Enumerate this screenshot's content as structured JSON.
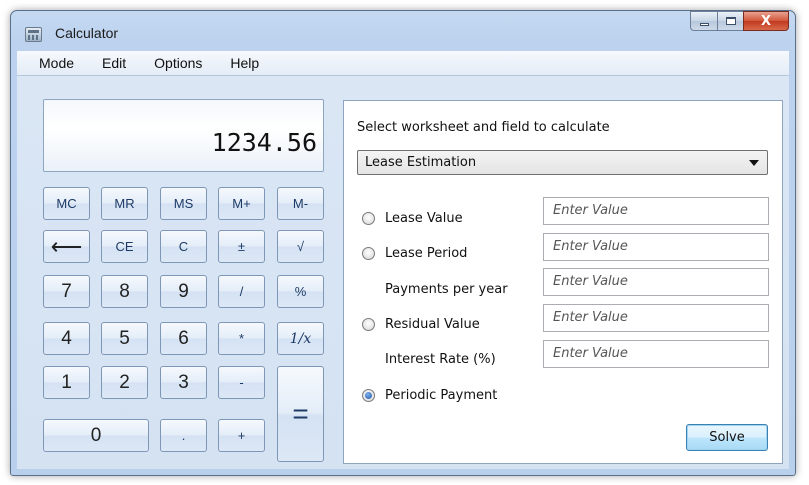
{
  "window": {
    "title": "Calculator",
    "close_glyph": "X"
  },
  "menu": [
    "Mode",
    "Edit",
    "Options",
    "Help"
  ],
  "display": {
    "value": "1234.56"
  },
  "keys": {
    "mc": "MC",
    "mr": "MR",
    "ms": "MS",
    "mplus": "M+",
    "mminus": "M-",
    "backspace": "⟵",
    "ce": "CE",
    "c": "C",
    "plusminus": "±",
    "sqrt": "√",
    "k7": "7",
    "k8": "8",
    "k9": "9",
    "div": "/",
    "pct": "%",
    "k4": "4",
    "k5": "5",
    "k6": "6",
    "mul": "*",
    "recip": "1/x",
    "k1": "1",
    "k2": "2",
    "k3": "3",
    "sub": "-",
    "eq": "=",
    "k0": "0",
    "dot": ".",
    "add": "+"
  },
  "worksheet": {
    "prompt": "Select worksheet and field to calculate",
    "selected": "Lease Estimation",
    "fields": [
      {
        "label": "Lease Value",
        "placeholder": "Enter Value",
        "radio": true,
        "checked": false
      },
      {
        "label": "Lease Period",
        "placeholder": "Enter Value",
        "radio": true,
        "checked": false
      },
      {
        "label": "Payments per year",
        "placeholder": "Enter Value",
        "radio": false
      },
      {
        "label": "Residual Value",
        "placeholder": "Enter Value",
        "radio": true,
        "checked": false
      },
      {
        "label": "Interest Rate (%)",
        "placeholder": "Enter Value",
        "radio": false
      },
      {
        "label": "Periodic Payment",
        "radio": true,
        "checked": true
      }
    ],
    "solve_label": "Solve"
  },
  "colors": {
    "frame": "#bcd2ee",
    "client": "#d7e4f3",
    "key_text": "#1d3a66",
    "close_button": "#c13a1f"
  },
  "icons": [
    "calculator-icon",
    "minimize-icon",
    "maximize-icon",
    "close-icon",
    "dropdown-arrow-icon"
  ]
}
